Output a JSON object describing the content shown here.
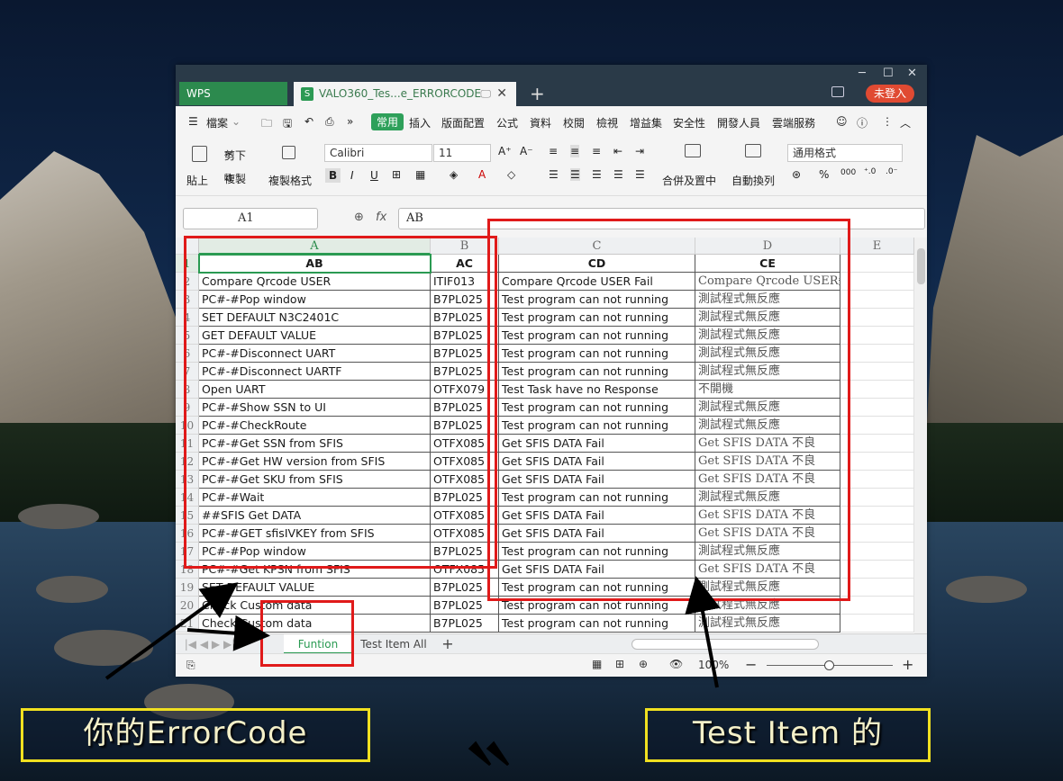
{
  "window": {
    "app_tab": "WPS Spreadsheets",
    "file_tab": "VALO360_Tes...e_ERRORCODE",
    "file_icon": "S",
    "login": "未登入"
  },
  "menu": [
    "檔案",
    "常用",
    "插入",
    "版面配置",
    "公式",
    "資料",
    "校閱",
    "檢視",
    "增益集",
    "安全性",
    "開發人員",
    "雲端服務"
  ],
  "ribbon": {
    "paste": "貼上",
    "cut": "剪下",
    "copy": "複製",
    "format_painter": "複製格式",
    "font_name": "Calibri",
    "font_size": "11",
    "merge_center": "合併及置中",
    "wrap_text": "自動換列",
    "number_format": "通用格式",
    "percent": "%",
    "thousands": "000"
  },
  "formula": {
    "name_box": "A1",
    "fx": "fx",
    "value": "AB"
  },
  "columns": [
    "A",
    "B",
    "C",
    "D",
    "E"
  ],
  "rows": [
    {
      "n": "1",
      "a": "AB",
      "b": "AC",
      "c": "CD",
      "d": "CE"
    },
    {
      "n": "2",
      "a": "Compare Qrcode USER",
      "b": "ITIF013",
      "c": "Compare Qrcode USER  Fail",
      "d": "Compare Qrcode USER失敗"
    },
    {
      "n": "3",
      "a": "PC#-#Pop window",
      "b": "B7PL025",
      "c": "Test program can not running",
      "d": "測試程式無反應"
    },
    {
      "n": "4",
      "a": "SET DEFAULT N3C2401C",
      "b": "B7PL025",
      "c": "Test program can not running",
      "d": "測試程式無反應"
    },
    {
      "n": "5",
      "a": "GET DEFAULT VALUE",
      "b": "B7PL025",
      "c": "Test program can not running",
      "d": "測試程式無反應"
    },
    {
      "n": "6",
      "a": "PC#-#Disconnect UART",
      "b": "B7PL025",
      "c": "Test program can not running",
      "d": "測試程式無反應"
    },
    {
      "n": "7",
      "a": "PC#-#Disconnect UARTF",
      "b": "B7PL025",
      "c": "Test program can not running",
      "d": "測試程式無反應"
    },
    {
      "n": "8",
      "a": "Open UART",
      "b": "OTFX079",
      "c": "Test Task have no Response",
      "d": "不開機"
    },
    {
      "n": "9",
      "a": "PC#-#Show SSN  to UI",
      "b": "B7PL025",
      "c": "Test program can not running",
      "d": "測試程式無反應"
    },
    {
      "n": "10",
      "a": "PC#-#CheckRoute",
      "b": "B7PL025",
      "c": "Test program can not running",
      "d": "測試程式無反應"
    },
    {
      "n": "11",
      "a": "PC#-#Get SSN from SFIS",
      "b": "OTFX085",
      "c": "Get SFIS DATA Fail",
      "d": "Get SFIS DATA 不良"
    },
    {
      "n": "12",
      "a": "PC#-#Get HW version from SFIS",
      "b": "OTFX085",
      "c": "Get SFIS DATA Fail",
      "d": "Get SFIS DATA 不良"
    },
    {
      "n": "13",
      "a": "PC#-#Get SKU from SFIS",
      "b": "OTFX085",
      "c": "Get SFIS DATA Fail",
      "d": "Get SFIS DATA 不良"
    },
    {
      "n": "14",
      "a": "PC#-#Wait",
      "b": "B7PL025",
      "c": "Test program can not running",
      "d": "測試程式無反應"
    },
    {
      "n": "15",
      "a": "##SFIS Get DATA",
      "b": "OTFX085",
      "c": "Get SFIS DATA Fail",
      "d": "Get SFIS DATA 不良"
    },
    {
      "n": "16",
      "a": "PC#-#GET sfisIVKEY from SFIS",
      "b": "OTFX085",
      "c": "Get SFIS DATA Fail",
      "d": "Get SFIS DATA 不良"
    },
    {
      "n": "17",
      "a": "PC#-#Pop window",
      "b": "B7PL025",
      "c": "Test program can not running",
      "d": "測試程式無反應"
    },
    {
      "n": "18",
      "a": "PC#-#Get KPSN  from SFIS",
      "b": "OTFX085",
      "c": "Get SFIS DATA Fail",
      "d": "Get SFIS DATA 不良"
    },
    {
      "n": "19",
      "a": "SET DEFAULT VALUE",
      "b": "B7PL025",
      "c": "Test program can not running",
      "d": "測試程式無反應"
    },
    {
      "n": "20",
      "a": "Check Custom data",
      "b": "B7PL025",
      "c": "Test program can not running",
      "d": "測試程式無反應"
    },
    {
      "n": "21",
      "a": "Check Custom data",
      "b": "B7PL025",
      "c": "Test program can not running",
      "d": "測試程式無反應"
    }
  ],
  "sheets": {
    "active": "Funtion",
    "other": "Test Item All"
  },
  "status": {
    "zoom": "100%"
  },
  "annotations": {
    "left_callout": "你的ErrorCode",
    "right_callout": "Test  Item 的"
  },
  "colors": {
    "accent": "#2a9a52",
    "annotation_red": "#e01a1a",
    "callout_yellow": "#f0e020"
  }
}
